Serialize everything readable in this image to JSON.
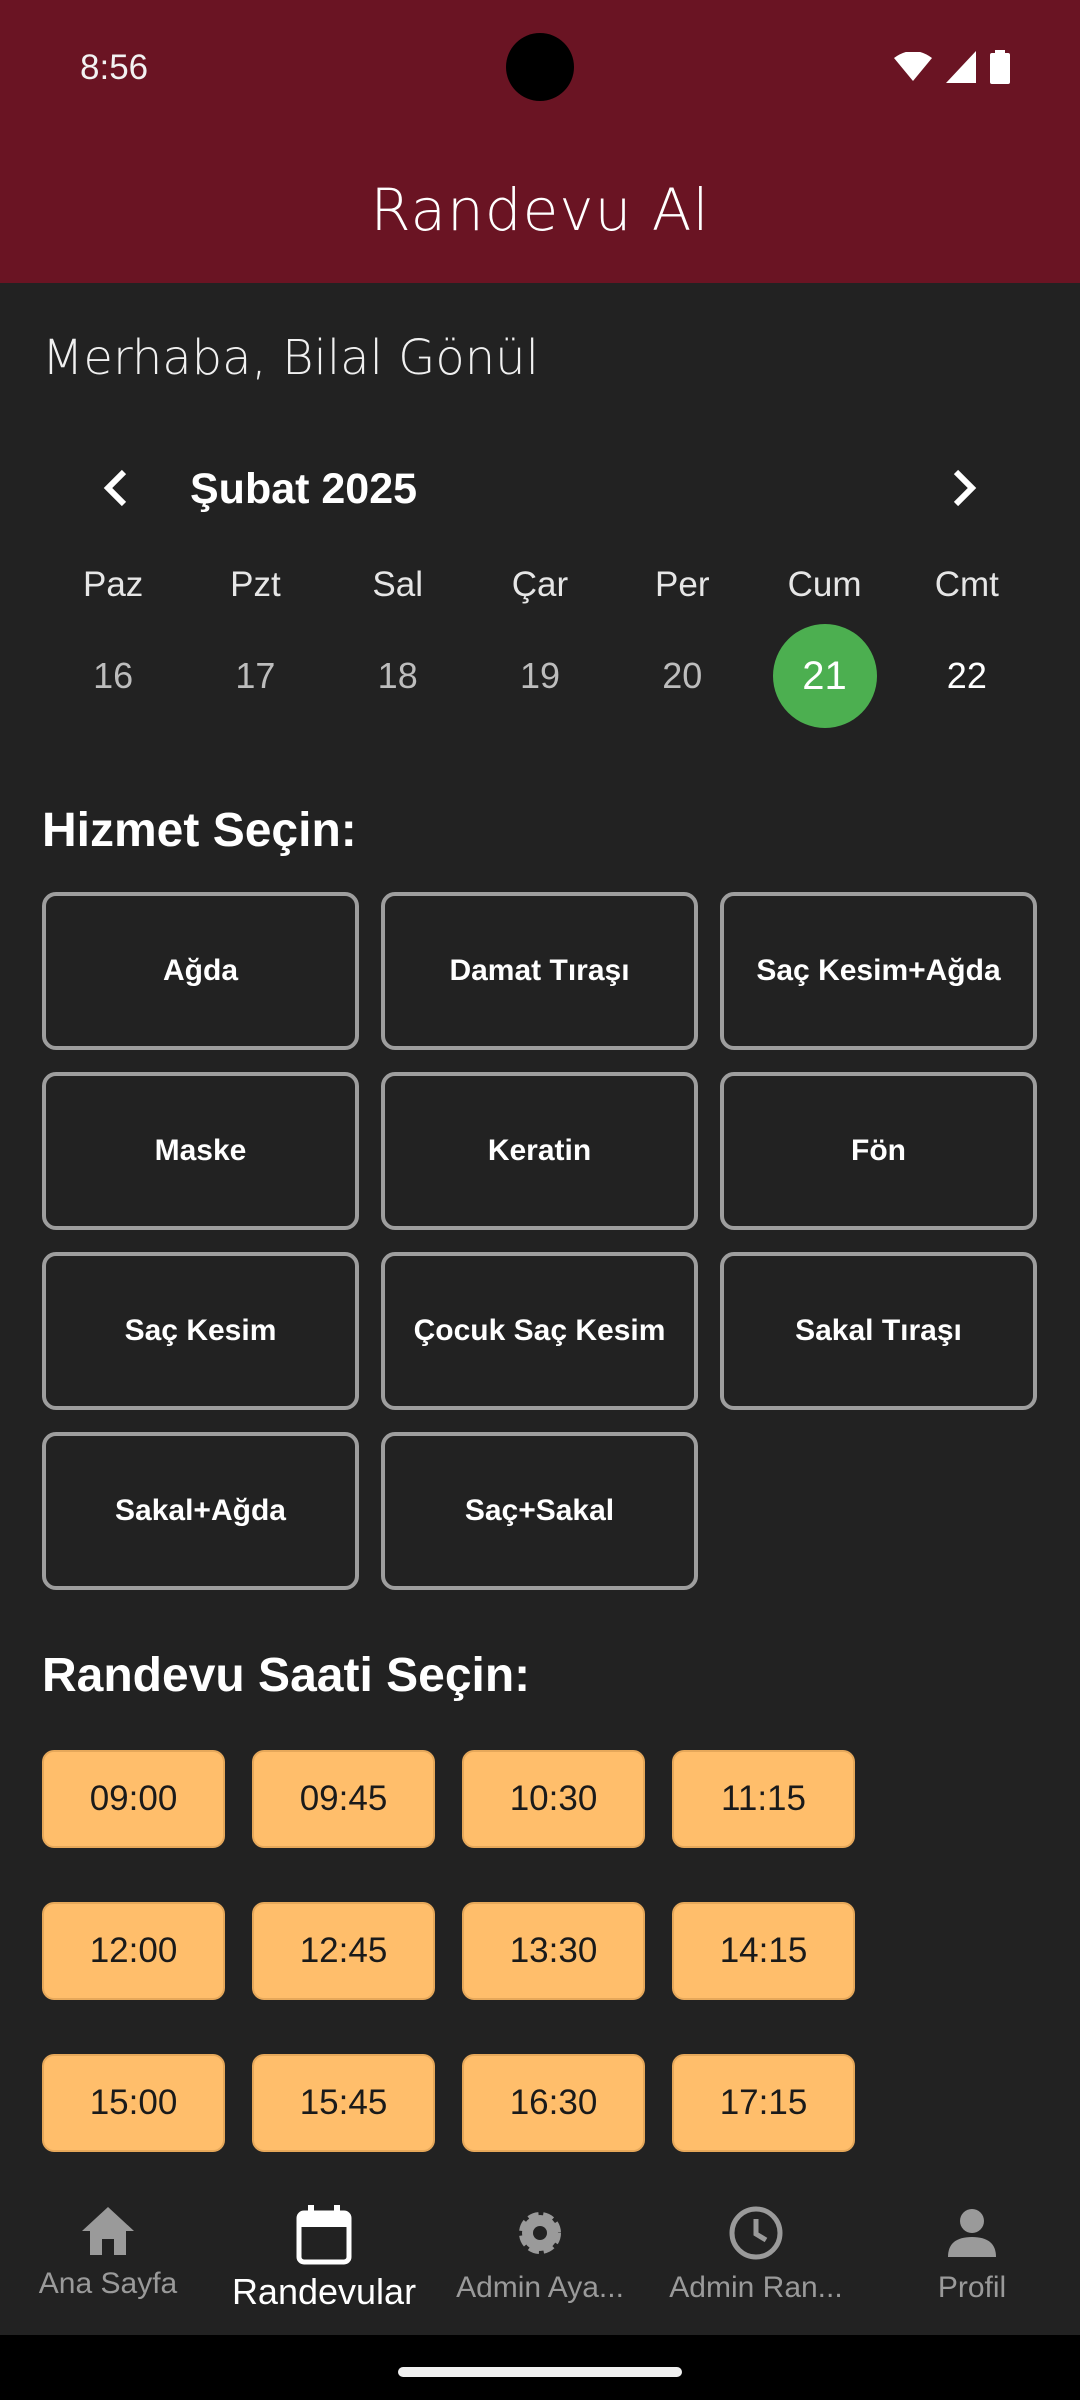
{
  "status_bar": {
    "time": "8:56"
  },
  "app_bar": {
    "title": "Randevu Al"
  },
  "greeting": "Merhaba, Bilal Gönül",
  "calendar": {
    "month_label": "Şubat 2025",
    "weekdays": [
      "Paz",
      "Pzt",
      "Sal",
      "Çar",
      "Per",
      "Cum",
      "Cmt"
    ],
    "days": [
      "16",
      "17",
      "18",
      "19",
      "20",
      "21",
      "22"
    ],
    "selected_day": "21",
    "accent_color": "#4caf50"
  },
  "services_section": {
    "title": "Hizmet Seçin:",
    "items": [
      "Ağda",
      "Damat Tıraşı",
      "Saç Kesim+Ağda",
      "Maske",
      "Keratin",
      "Fön",
      "Saç Kesim",
      "Çocuk Saç Kesim",
      "Sakal Tıraşı",
      "Sakal+Ağda",
      "Saç+Sakal"
    ]
  },
  "time_section": {
    "title": "Randevu Saati Seçin:",
    "slots": [
      "09:00",
      "09:45",
      "10:30",
      "11:15",
      "12:00",
      "12:45",
      "13:30",
      "14:15",
      "15:00",
      "15:45",
      "16:30",
      "17:15"
    ],
    "slot_color": "#ffbe6b"
  },
  "bottom_nav": {
    "items": [
      {
        "label": "Ana Sayfa",
        "icon": "home-icon"
      },
      {
        "label": "Randevular",
        "icon": "calendar-icon",
        "active": true
      },
      {
        "label": "Admin Aya...",
        "icon": "gear-icon"
      },
      {
        "label": "Admin Ran...",
        "icon": "clock-icon"
      },
      {
        "label": "Profil",
        "icon": "person-icon"
      }
    ]
  },
  "colors": {
    "app_bar": "#6a1423",
    "background": "#222222"
  }
}
